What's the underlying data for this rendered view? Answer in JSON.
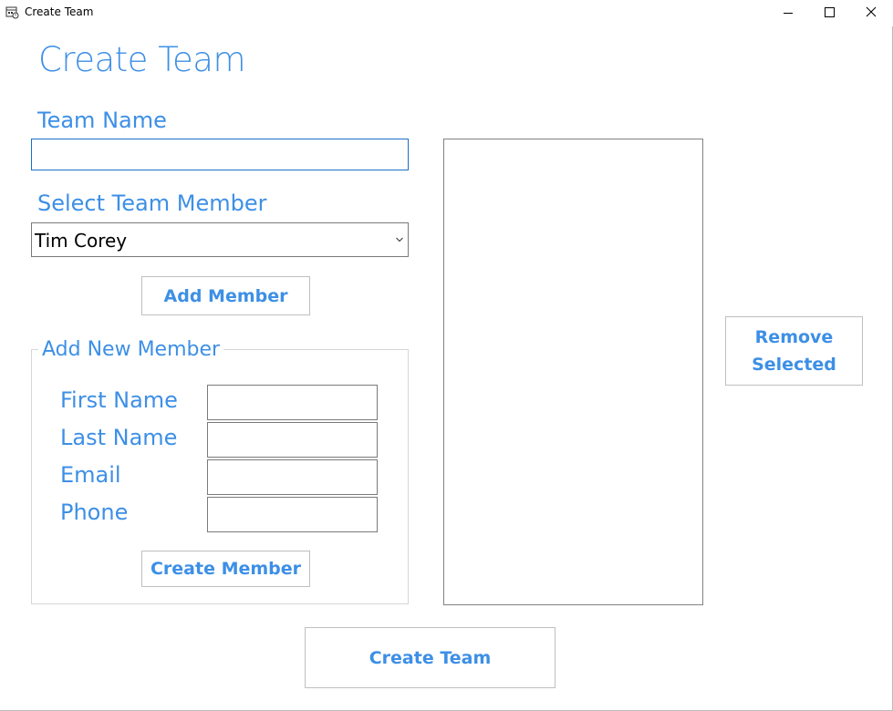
{
  "window": {
    "title": "Create Team",
    "controls": {
      "minimize_icon": "minimize-icon",
      "maximize_icon": "maximize-icon",
      "close_icon": "close-icon"
    }
  },
  "form": {
    "heading": "Create Team",
    "team_name": {
      "label": "Team Name",
      "value": ""
    },
    "select_member": {
      "label": "Select Team Member",
      "selected": "Tim Corey"
    },
    "add_member_button": "Add Member",
    "new_member_group": {
      "title": "Add New Member",
      "fields": [
        {
          "label": "First Name",
          "value": ""
        },
        {
          "label": "Last Name",
          "value": ""
        },
        {
          "label": "Email",
          "value": ""
        },
        {
          "label": "Phone",
          "value": ""
        }
      ],
      "create_member_button": "Create Member"
    },
    "team_members_list": [],
    "remove_selected_button": [
      "Remove",
      "Selected"
    ],
    "create_team_button": "Create Team"
  },
  "colors": {
    "accent": "#3d8fe6",
    "focus_border": "#1a6fc4"
  }
}
